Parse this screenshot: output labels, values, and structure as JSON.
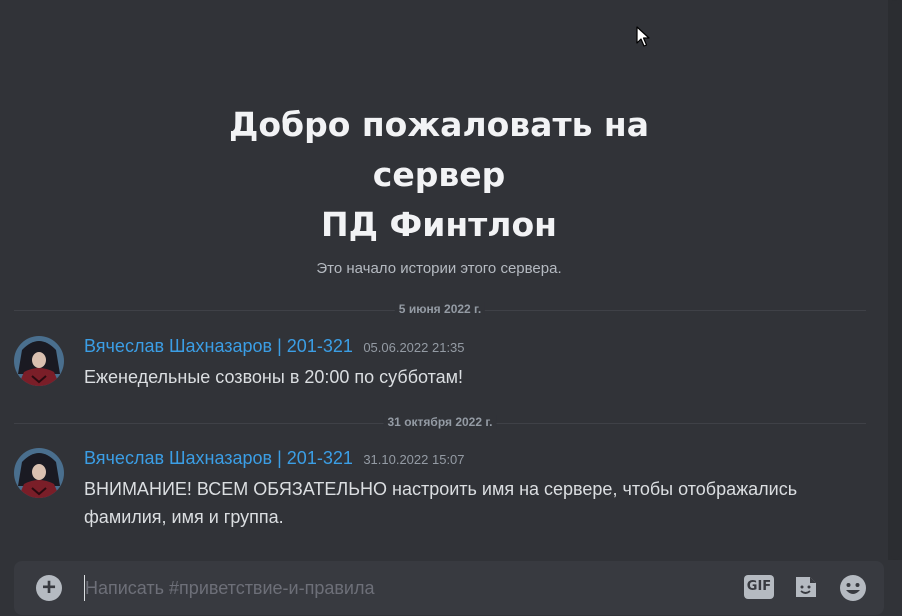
{
  "welcome": {
    "title": "Добро пожаловать на\nсервер\nПД Финтлон",
    "subtitle": "Это начало истории этого сервера."
  },
  "dividers": [
    {
      "label": "5 июня 2022 г."
    },
    {
      "label": "31 октября 2022 г."
    }
  ],
  "messages": [
    {
      "author": "Вячеслав Шахназаров | 201-321",
      "timestamp": "05.06.2022 21:35",
      "text": "Еженедельные созвоны в 20:00 по субботам!"
    },
    {
      "author": "Вячеслав Шахназаров | 201-321",
      "timestamp": "31.10.2022 15:07",
      "text": "ВНИМАНИЕ! ВСЕМ ОБЯЗАТЕЛЬНО настроить имя на сервере, чтобы отображались фамилия, имя и группа."
    }
  ],
  "composer": {
    "placeholder": "Написать #приветствие-и-правила",
    "value": "",
    "add_icon": "plus-circle-icon",
    "gif_label": "GIF",
    "sticker_icon": "sticker-icon",
    "emoji_icon": "emoji-smile-icon"
  },
  "colors": {
    "background": "#313338",
    "author": "#3b9ee5",
    "composer_bg": "#383a40",
    "muted": "#949ba4"
  }
}
